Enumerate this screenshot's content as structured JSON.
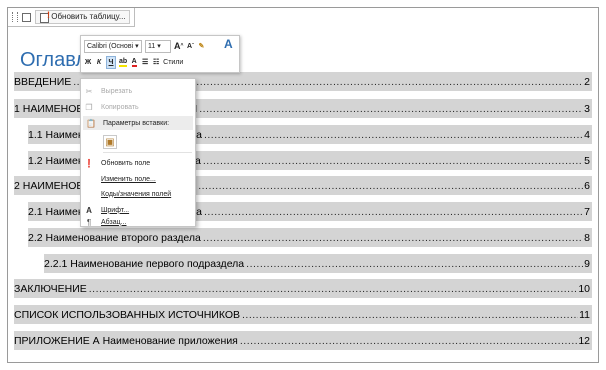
{
  "field_tab": {
    "update_label": "Обновить таблицу..."
  },
  "toc": {
    "title": "Оглавление",
    "entries": [
      {
        "text": "ВВЕДЕНИЕ",
        "page": "2",
        "indent": 0
      },
      {
        "text": "1 НАИМЕНОВАНИЕ ПЕРВОЙ ГЛАВЫ",
        "page": "3",
        "indent": 0
      },
      {
        "text": "1.1 Наименование первого раздела",
        "page": "4",
        "indent": 1
      },
      {
        "text": "1.2 Наименование второго раздела",
        "page": "5",
        "indent": 1
      },
      {
        "text": "2 НАИМЕНОВАНИЕ ВТОРОЙ ГЛАВЫ",
        "page": "6",
        "indent": 0
      },
      {
        "text": "2.1 Наименование первого раздела",
        "page": "7",
        "indent": 1
      },
      {
        "text": "2.2 Наименование второго раздела",
        "page": "8",
        "indent": 1
      },
      {
        "text": "2.2.1 Наименование первого подраздела",
        "page": "9",
        "indent": 2
      },
      {
        "text": "ЗАКЛЮЧЕНИЕ",
        "page": "10",
        "indent": 0
      },
      {
        "text": "СПИСОК ИСПОЛЬЗОВАННЫХ ИСТОЧНИКОВ",
        "page": "11",
        "indent": 0
      },
      {
        "text": "ПРИЛОЖЕНИЕ А Наименование приложения",
        "page": "12",
        "indent": 0
      }
    ]
  },
  "mini_toolbar": {
    "font_name": "Calibri (Основі",
    "font_size": "11",
    "grow_font": "A",
    "shrink_font": "A",
    "bold": "Ж",
    "italic": "К",
    "underline": "Ч",
    "font_color": "A",
    "styles_label": "Стили"
  },
  "context_menu": {
    "cut": "Вырезать",
    "copy": "Копировать",
    "paste_options": "Параметры вставки:",
    "update_field": "Обновить поле",
    "edit_field": "Изменить поле...",
    "toggle_codes": "Коды/значения полей",
    "font": "Шрифт...",
    "paragraph": "Абзац..."
  },
  "colors": {
    "toc_title": "#2e6db0",
    "field_shading": "#d4d4d4",
    "menu_header": "#ececec"
  }
}
